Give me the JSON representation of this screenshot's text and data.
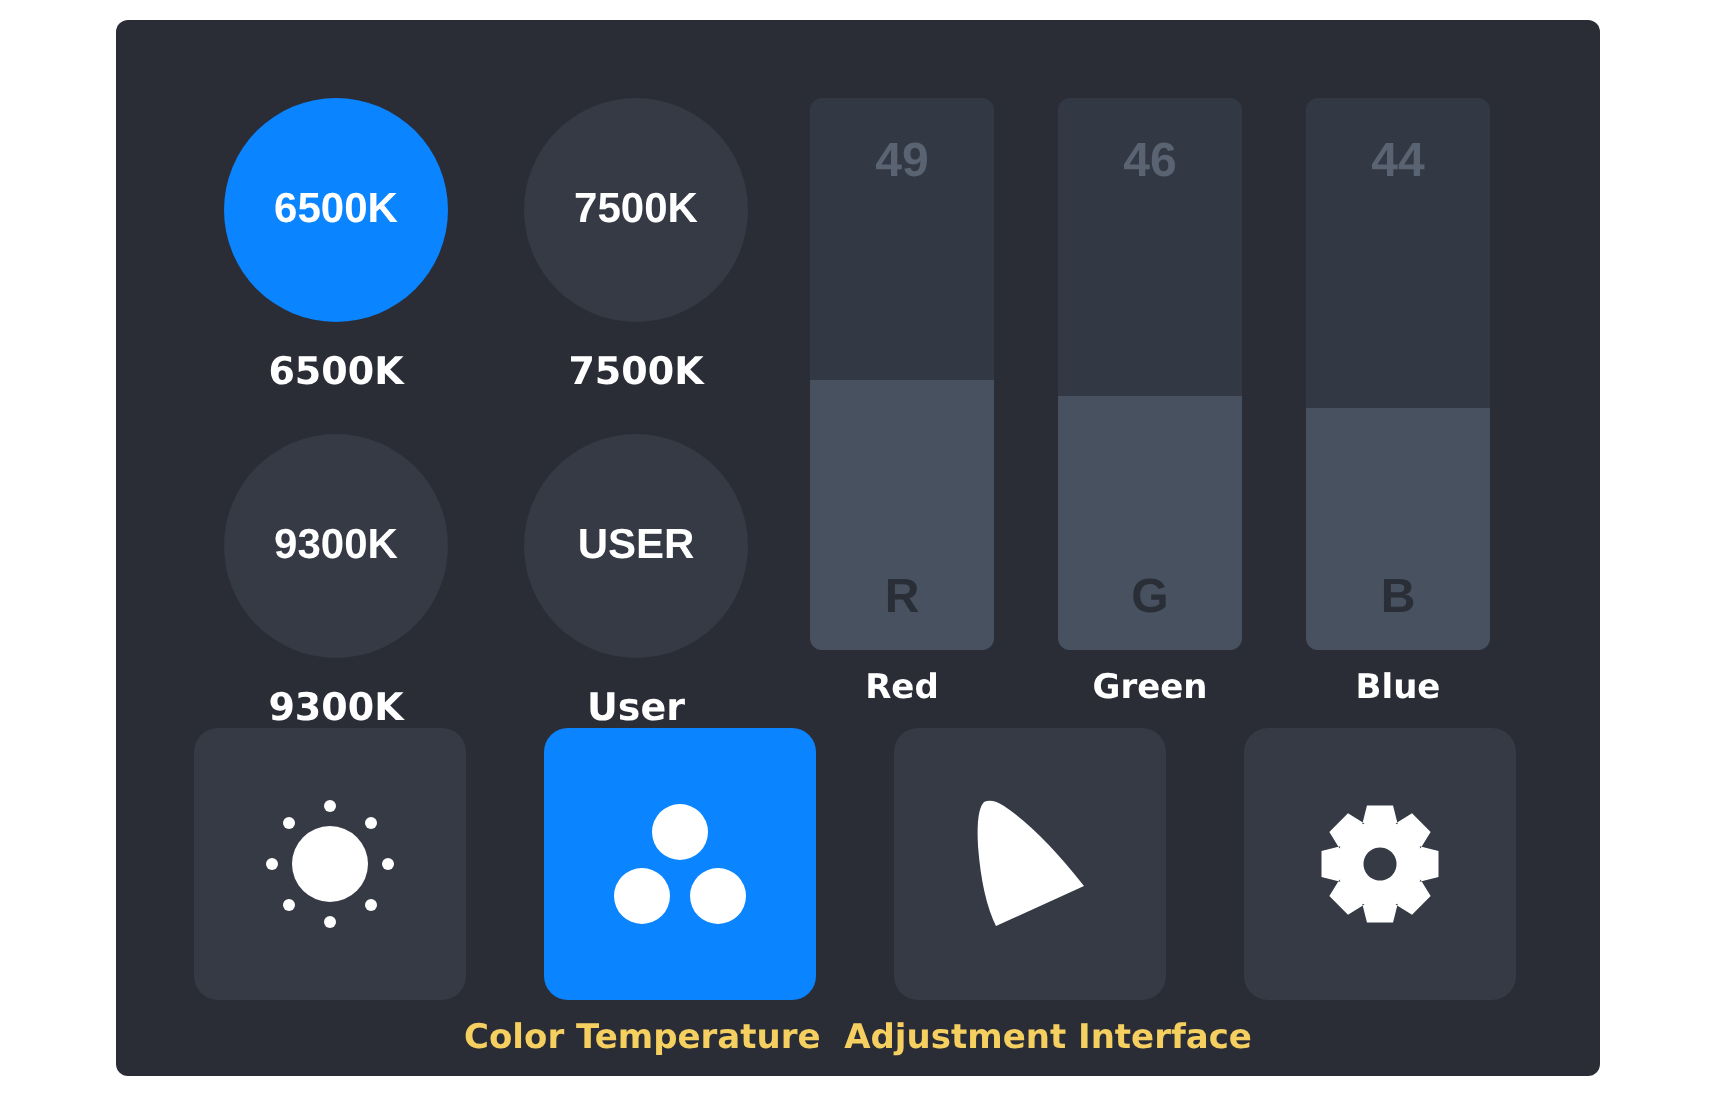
{
  "presets": [
    {
      "badge": "6500K",
      "label": "6500K",
      "selected": true
    },
    {
      "badge": "7500K",
      "label": "7500K",
      "selected": false
    },
    {
      "badge": "9300K",
      "label": "9300K",
      "selected": false
    },
    {
      "badge": "USER",
      "label": "User",
      "selected": false
    }
  ],
  "channels": [
    {
      "value": "49",
      "letter": "R",
      "name": "Red",
      "level": 0.49
    },
    {
      "value": "46",
      "letter": "G",
      "name": "Green",
      "level": 0.46
    },
    {
      "value": "44",
      "letter": "B",
      "name": "Blue",
      "level": 0.44
    }
  ],
  "toolbar": [
    {
      "kind": "brightness",
      "selected": false
    },
    {
      "kind": "color",
      "selected": true
    },
    {
      "kind": "gamut",
      "selected": false
    },
    {
      "kind": "settings",
      "selected": false
    }
  ],
  "caption": "Color Temperature  Adjustment Interface"
}
